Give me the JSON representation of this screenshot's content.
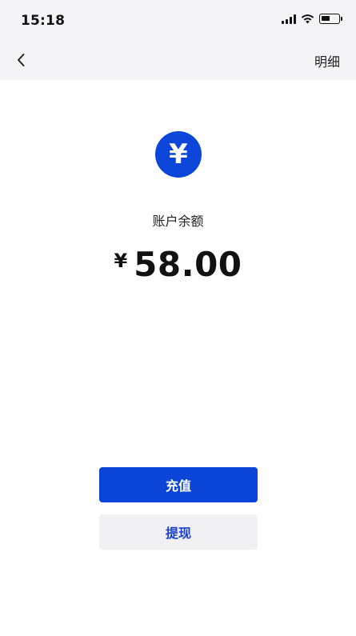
{
  "status_bar": {
    "time": "15:18",
    "battery_level": 0.5,
    "signal_icon": "cellular-signal-icon",
    "wifi_icon": "wifi-icon",
    "battery_icon": "battery-icon"
  },
  "nav": {
    "back_icon": "chevron-left-icon",
    "detail_label": "明细"
  },
  "balance": {
    "icon": "yen-coin-icon",
    "icon_symbol": "¥",
    "label": "账户余额",
    "currency_symbol": "¥",
    "amount": "58.00"
  },
  "actions": {
    "recharge_label": "充值",
    "withdraw_label": "提现"
  },
  "colors": {
    "primary_blue": "#0a45d8",
    "top_background": "#f4f4f6",
    "secondary_button_bg": "#f1f1f3"
  }
}
